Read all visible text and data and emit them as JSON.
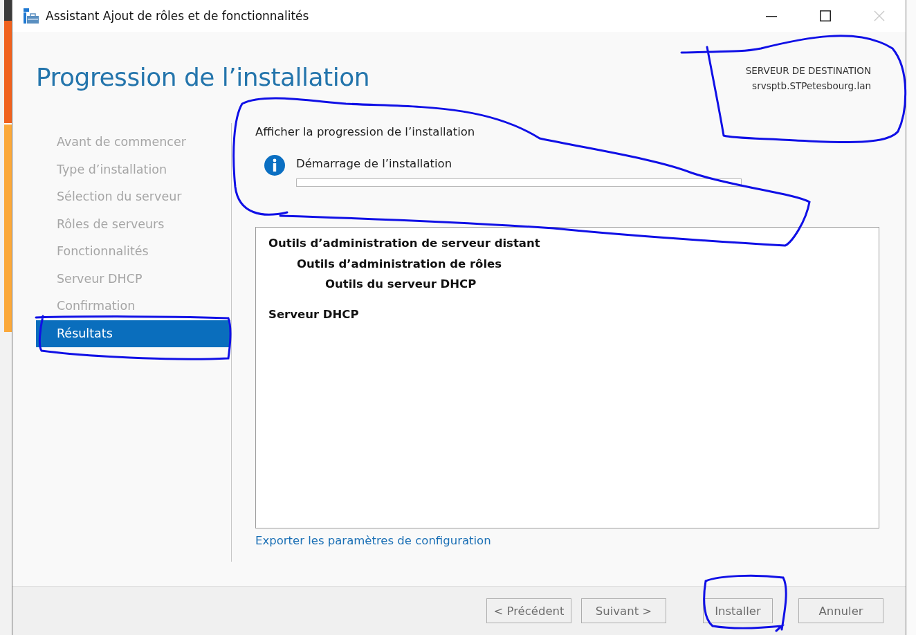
{
  "window": {
    "title": "Assistant Ajout de rôles et de fonctionnalités"
  },
  "header": {
    "title": "Progression de l’installation",
    "destination_label": "SERVEUR DE DESTINATION",
    "destination_server": "srvsptb.STPetesbourg.lan"
  },
  "steps": [
    {
      "label": "Avant de commencer",
      "selected": false
    },
    {
      "label": "Type d’installation",
      "selected": false
    },
    {
      "label": "Sélection du serveur",
      "selected": false
    },
    {
      "label": "Rôles de serveurs",
      "selected": false
    },
    {
      "label": "Fonctionnalités",
      "selected": false
    },
    {
      "label": "Serveur DHCP",
      "selected": false
    },
    {
      "label": "Confirmation",
      "selected": false
    },
    {
      "label": "Résultats",
      "selected": true
    }
  ],
  "content": {
    "heading": "Afficher la progression de l’installation",
    "status": {
      "message": "Démarrage de l’installation",
      "level": 0
    },
    "results": [
      {
        "label": "Outils d’administration de serveur distant",
        "children": [
          {
            "label": "Outils d’administration de rôles",
            "children": [
              {
                "label": "Outils du serveur DHCP"
              }
            ]
          }
        ]
      },
      {
        "label": "Serveur DHCP"
      }
    ],
    "link": "Exporter les paramètres de configuration"
  },
  "buttons": [
    {
      "label": "< Précédent"
    },
    {
      "label": "Suivant >"
    },
    {
      "label": "Installer"
    },
    {
      "label": "Annuler"
    }
  ]
}
